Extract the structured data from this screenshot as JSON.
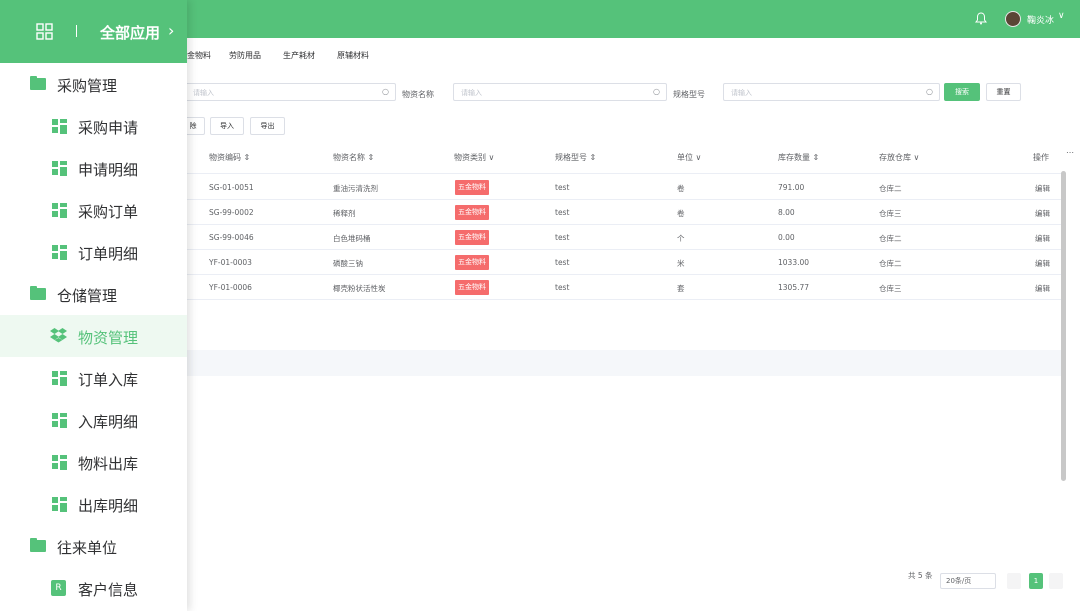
{
  "header": {
    "user_name": "鞠炎冰",
    "user_dropdown": "∨"
  },
  "nav_panel": {
    "title": "全部应用",
    "groups": [
      {
        "label": "采购管理",
        "items": [
          "采购申请",
          "申请明细",
          "采购订单",
          "订单明细"
        ]
      },
      {
        "label": "仓储管理",
        "items": [
          "物资管理",
          "订单入库",
          "入库明细",
          "物料出库",
          "出库明细"
        ]
      },
      {
        "label": "往来单位",
        "items": [
          "客户信息"
        ]
      }
    ],
    "active_item": "物资管理",
    "customer_icon_letter": "R"
  },
  "tabs": [
    "金物料",
    "劳防用品",
    "生产耗材",
    "原辅材料"
  ],
  "filters": {
    "first_placeholder": "请输入",
    "name_label": "物资名称",
    "name_placeholder": "请输入",
    "model_label": "规格型号",
    "model_placeholder": "请输入",
    "search_btn": "搜索",
    "reset_btn": "重置"
  },
  "toolbar": {
    "delete": "除",
    "import": "导入",
    "export": "导出"
  },
  "table": {
    "headers": [
      "物资编码 ⇕",
      "物资名称 ⇕",
      "物资类别 ∨",
      "规格型号 ⇕",
      "单位 ∨",
      "库存数量 ⇕",
      "存放仓库 ∨",
      "操作"
    ],
    "rows": [
      {
        "code": "SG-01-0051",
        "name": "重油污清洗剂",
        "category": "五金物料",
        "model": "test",
        "unit": "卷",
        "qty": "791.00",
        "warehouse": "仓库二",
        "action": "编辑"
      },
      {
        "code": "SG-99-0002",
        "name": "稀释剂",
        "category": "五金物料",
        "model": "test",
        "unit": "卷",
        "qty": "8.00",
        "warehouse": "仓库三",
        "action": "编辑"
      },
      {
        "code": "SG-99-0046",
        "name": "白色堆码桶",
        "category": "五金物料",
        "model": "test",
        "unit": "个",
        "qty": "0.00",
        "warehouse": "仓库二",
        "action": "编辑"
      },
      {
        "code": "YF-01-0003",
        "name": "磷酸三钠",
        "category": "五金物料",
        "model": "test",
        "unit": "米",
        "qty": "1033.00",
        "warehouse": "仓库二",
        "action": "编辑"
      },
      {
        "code": "YF-01-0006",
        "name": "椰壳粉状活性炭",
        "category": "五金物料",
        "model": "test",
        "unit": "套",
        "qty": "1305.77",
        "warehouse": "仓库三",
        "action": "编辑"
      }
    ]
  },
  "pagination": {
    "total": "共 5 条",
    "page_size": "20条/页",
    "current": "1"
  },
  "colors": {
    "brand": "#55c27a",
    "tag": "#f56c6c"
  }
}
